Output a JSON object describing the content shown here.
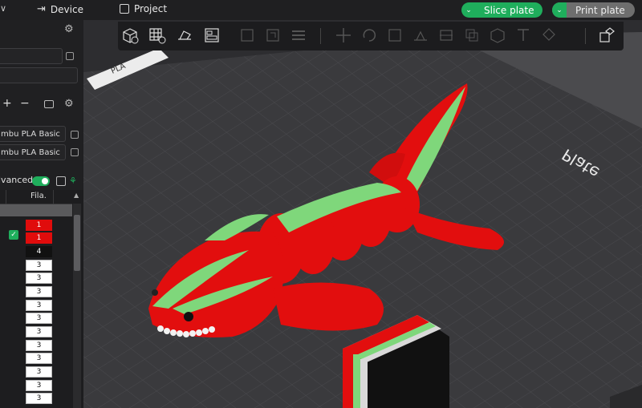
{
  "topbar": {
    "device_label": "Device",
    "project_label": "Project",
    "slice_button": "Slice plate",
    "print_button": "Print plate",
    "accent_color": "#1fae5c"
  },
  "left_panel": {
    "filament_1": "mbu PLA Basic",
    "filament_2": "mbu PLA Basic",
    "plus_label": "+",
    "minus_label": "−",
    "advanced_label": "lvanced",
    "table_header": "Fila.",
    "filament_values": [
      "1",
      "1",
      "4",
      "3",
      "3",
      "3",
      "3",
      "3",
      "3",
      "3",
      "3",
      "3",
      "3",
      "3"
    ]
  },
  "viewport": {
    "plate_label": "PLA",
    "plate_text": "Plate",
    "model_colors": {
      "body": "#e20e0e",
      "stripe": "#7fd77b",
      "teeth": "#f2f2f2"
    }
  }
}
